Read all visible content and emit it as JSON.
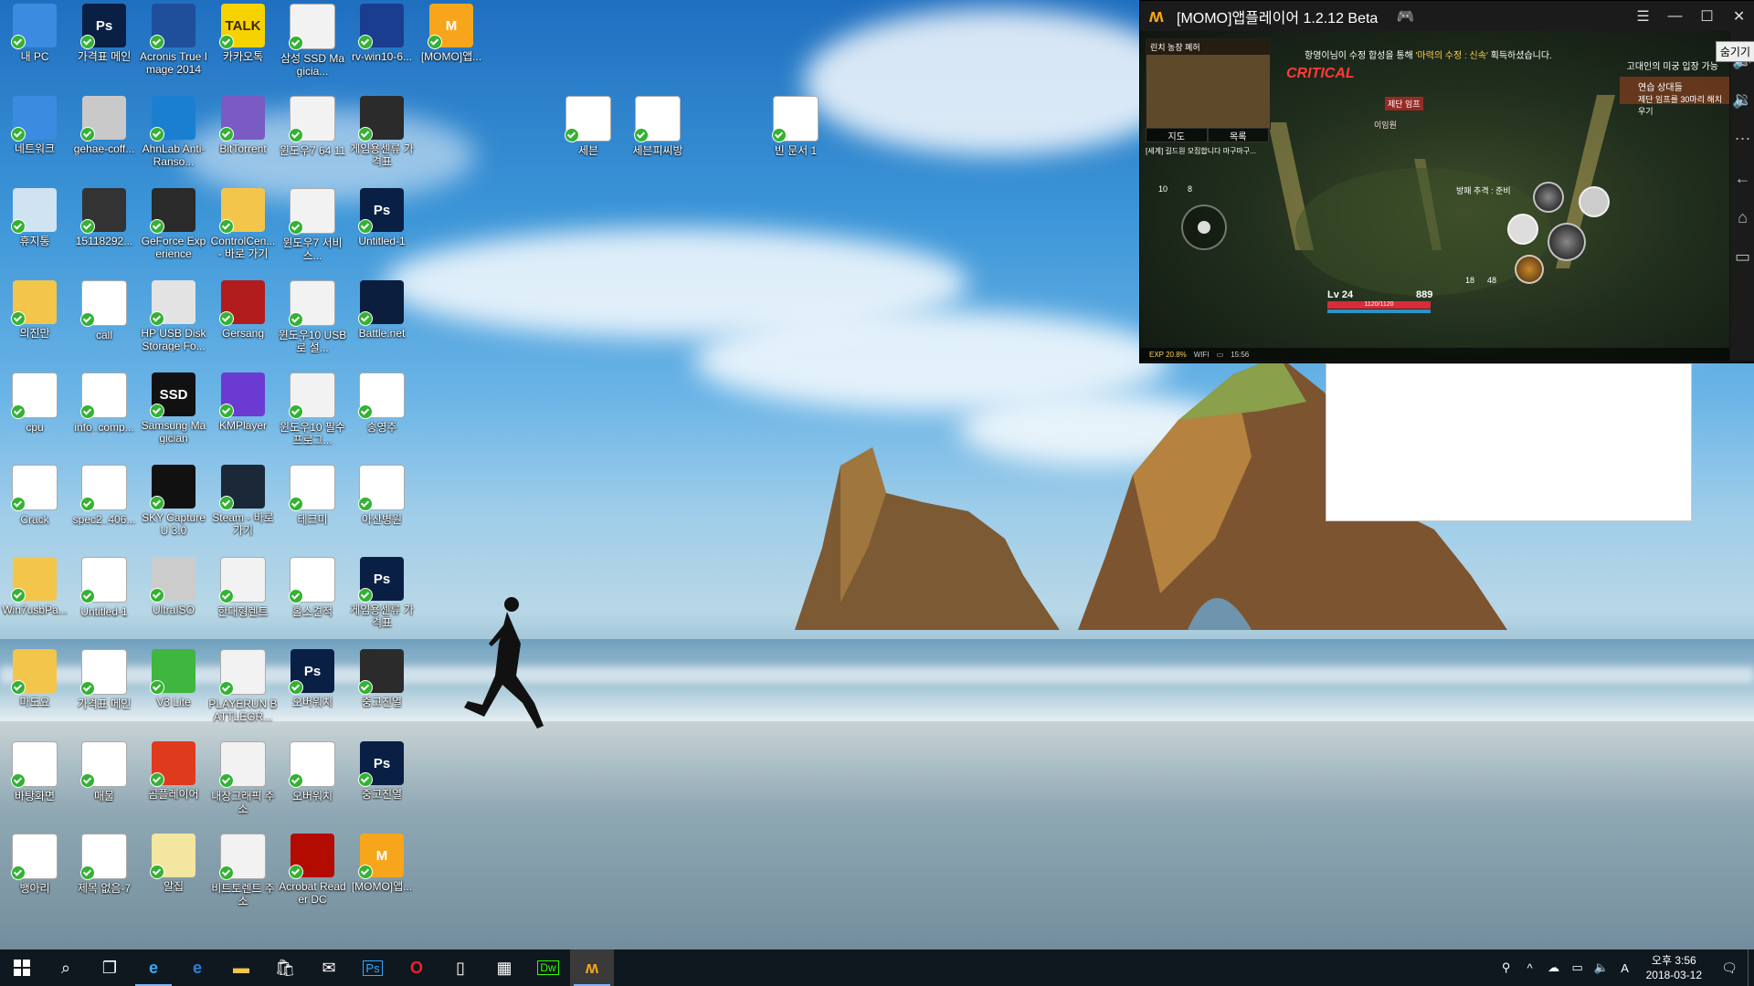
{
  "desktop_icons": [
    {
      "label": "내 PC",
      "icon": "computer-icon",
      "color": "#3b8be0"
    },
    {
      "label": "가격표 메인",
      "icon": "photoshop-icon",
      "color": "#0a1f44",
      "glyph": "Ps"
    },
    {
      "label": "Acronis True Image 2014",
      "icon": "acronis-icon",
      "color": "#1f4e9a"
    },
    {
      "label": "카카오톡",
      "icon": "kakaotalk-icon",
      "color": "#f6d200",
      "glyph": "TALK"
    },
    {
      "label": "삼성 SSD Magicia...",
      "icon": "file-icon",
      "color": "#f2f2f2"
    },
    {
      "label": "rv-win10-6...",
      "icon": "app-icon",
      "color": "#1b3d8f"
    },
    {
      "label": "[MOMO]앱...",
      "icon": "momo-icon",
      "color": "#f7a61c",
      "glyph": "M"
    },
    {
      "label": "네트워크",
      "icon": "network-icon",
      "color": "#3b8be0"
    },
    {
      "label": "gehae-coff...",
      "icon": "image-icon",
      "color": "#c9c9c9"
    },
    {
      "label": "AhnLab Anti-Ranso...",
      "icon": "ahnlab-icon",
      "color": "#1a7fd0"
    },
    {
      "label": "BitTorrent",
      "icon": "bittorrent-icon",
      "color": "#7a5bc4"
    },
    {
      "label": "윈도우7 64 11",
      "icon": "file-icon",
      "color": "#f2f2f2"
    },
    {
      "label": "게임용센류 가격표",
      "icon": "image-icon",
      "color": "#2b2b2b"
    },
    {
      "label": "휴지통",
      "icon": "recycle-bin-icon",
      "color": "#cfe3f2"
    },
    {
      "label": "15118292...",
      "icon": "image-icon",
      "color": "#333"
    },
    {
      "label": "GeForce Experience",
      "icon": "nvidia-icon",
      "color": "#2a2a2a"
    },
    {
      "label": "ControlCen... - 바로 가기",
      "icon": "folder-icon",
      "color": "#f3c54b"
    },
    {
      "label": "윈도우7 서비스...",
      "icon": "file-icon",
      "color": "#f2f2f2"
    },
    {
      "label": "Untitled-1",
      "icon": "photoshop-icon",
      "color": "#0a1f44",
      "glyph": "Ps"
    },
    {
      "label": "의진만",
      "icon": "user-folder-icon",
      "color": "#f3c54b"
    },
    {
      "label": "call",
      "icon": "document-icon",
      "color": "#fff"
    },
    {
      "label": "HP USB Disk Storage Fo...",
      "icon": "hp-icon",
      "color": "#e3e3e3"
    },
    {
      "label": "Gersang",
      "icon": "gersang-icon",
      "color": "#b21c1c"
    },
    {
      "label": "윈도우10 USB로 설...",
      "icon": "file-icon",
      "color": "#f2f2f2"
    },
    {
      "label": "Battle.net",
      "icon": "battlenet-icon",
      "color": "#0c1e3d"
    },
    {
      "label": "cpu",
      "icon": "app-icon",
      "color": "#fff"
    },
    {
      "label": "info_comp...",
      "icon": "document-icon",
      "color": "#fff"
    },
    {
      "label": "Samsung Magician",
      "icon": "samsung-ssd-icon",
      "color": "#111",
      "glyph": "SSD"
    },
    {
      "label": "KMPlayer",
      "icon": "kmplayer-icon",
      "color": "#6b3bd1"
    },
    {
      "label": "윈도우10 필수프로그...",
      "icon": "file-icon",
      "color": "#f2f2f2"
    },
    {
      "label": "송영주",
      "icon": "pdf-icon",
      "color": "#fff"
    },
    {
      "label": "Crack",
      "icon": "winrar-icon",
      "color": "#fff"
    },
    {
      "label": "spec2_406...",
      "icon": "document-icon",
      "color": "#fff"
    },
    {
      "label": "SKY CaptureU 3.0",
      "icon": "skycapture-icon",
      "color": "#111"
    },
    {
      "label": "Steam - 바로 가기",
      "icon": "steam-icon",
      "color": "#1b2838"
    },
    {
      "label": "테크미",
      "icon": "ie-doc-icon",
      "color": "#fff"
    },
    {
      "label": "아산병원",
      "icon": "ie-doc-icon",
      "color": "#fff"
    },
    {
      "label": "Win7usbPa...",
      "icon": "folder-icon",
      "color": "#f3c54b"
    },
    {
      "label": "Untitled-1",
      "icon": "image-icon",
      "color": "#fff"
    },
    {
      "label": "UltraISO",
      "icon": "ultraiso-icon",
      "color": "#ccc"
    },
    {
      "label": "한대형렌트",
      "icon": "file-icon",
      "color": "#f2f2f2"
    },
    {
      "label": "홀스견적",
      "icon": "ie-doc-icon",
      "color": "#fff"
    },
    {
      "label": "게임용센류 가격표",
      "icon": "photoshop-icon",
      "color": "#0a1f44",
      "glyph": "Ps"
    },
    {
      "label": "마도요",
      "icon": "folder-icon",
      "color": "#f3c54b"
    },
    {
      "label": "가격표 메인",
      "icon": "image-icon",
      "color": "#fff"
    },
    {
      "label": "V3 Lite",
      "icon": "v3-icon",
      "color": "#3fb63f"
    },
    {
      "label": "PLAYERUN BATTLEGR...",
      "icon": "file-icon",
      "color": "#f2f2f2"
    },
    {
      "label": "오버워치",
      "icon": "photoshop-icon",
      "color": "#0a1f44",
      "glyph": "Ps"
    },
    {
      "label": "중고진열",
      "icon": "image-icon",
      "color": "#2b2b2b"
    },
    {
      "label": "바탕화면",
      "icon": "winrar-icon",
      "color": "#fff"
    },
    {
      "label": "매물",
      "icon": "image-icon",
      "color": "#fff"
    },
    {
      "label": "곰플레이어",
      "icon": "gomplayer-icon",
      "color": "#e03a1e"
    },
    {
      "label": "내장그래픽 주소",
      "icon": "file-icon",
      "color": "#f2f2f2"
    },
    {
      "label": "오버워치",
      "icon": "image-icon",
      "color": "#fff"
    },
    {
      "label": "중고진열",
      "icon": "photoshop-icon",
      "color": "#0a1f44",
      "glyph": "Ps"
    },
    {
      "label": "뱅아리",
      "icon": "winrar-icon",
      "color": "#fff"
    },
    {
      "label": "제목 없음-7",
      "icon": "image-icon",
      "color": "#fff"
    },
    {
      "label": "알집",
      "icon": "alzip-icon",
      "color": "#f3e6a0"
    },
    {
      "label": "비트토렌트 주소",
      "icon": "file-icon",
      "color": "#f2f2f2"
    },
    {
      "label": "Acrobat Reader DC",
      "icon": "acrobat-icon",
      "color": "#b30b00"
    },
    {
      "label": "[MOMO]앱...",
      "icon": "momo-icon",
      "color": "#f7a61c",
      "glyph": "M"
    }
  ],
  "extra_icons": [
    {
      "label": "세븐",
      "icon": "pdf-icon"
    },
    {
      "label": "세븐피씨방",
      "icon": "pdf-icon"
    },
    {
      "label": "빈 문서 1",
      "icon": "ie-doc-icon"
    }
  ],
  "momo": {
    "title": "[MOMO]앱플레이어 1.2.12 Beta",
    "hide_label": "숨기기",
    "minimap_title": "린치 농장 폐허",
    "tabs": [
      "지도",
      "목록"
    ],
    "notice_pre": "항영이님이 수정 합성을 통해 ",
    "notice_hl": "'마력의 수정 : 신속'",
    "notice_post": " 획득하셨습니다.",
    "critical": "CRITICAL",
    "dungeon": "고대인의 미궁 입장 가능",
    "quest_title": "연습 상대들",
    "quest_sub": "제단 임프를 30마리 해치우기",
    "chat": "[세계] 길드원 모집합니다 마구마구...",
    "gate_label": "제단 임프",
    "enemy_label": "이임원",
    "follow_label": "방패 추격 : 준비",
    "level": "Lv 24",
    "gold": "889",
    "hp": "1120/1120",
    "exp": "EXP 20.8%",
    "wifi": "WIFI",
    "time": "15:56",
    "count_a": "18",
    "count_b": "48",
    "buff_a": "10",
    "buff_b": "8"
  },
  "taskbar": {
    "buttons": [
      "start",
      "search",
      "task-view",
      "ie",
      "edge",
      "explorer",
      "store",
      "mail",
      "photoshop",
      "opera",
      "notepad",
      "calculator",
      "dreamweaver",
      "momo"
    ],
    "clock_time": "오후 3:56",
    "clock_date": "2018-03-12",
    "ime": "A"
  }
}
